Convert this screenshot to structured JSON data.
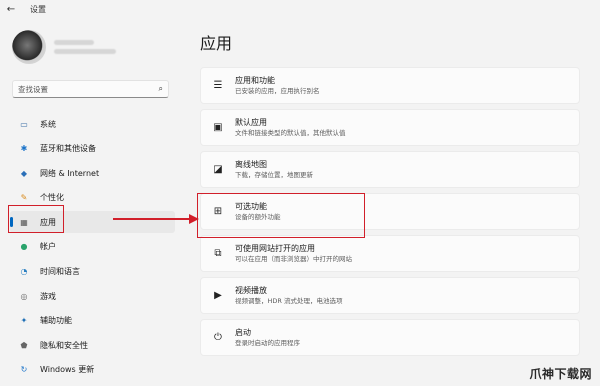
{
  "window": {
    "title": "设置"
  },
  "search": {
    "placeholder": "查找设置"
  },
  "sidebar": {
    "items": [
      {
        "label": "系统",
        "icon": "display-icon"
      },
      {
        "label": "蓝牙和其他设备",
        "icon": "bluetooth-icon"
      },
      {
        "label": "网络 & Internet",
        "icon": "wifi-icon"
      },
      {
        "label": "个性化",
        "icon": "brush-icon"
      },
      {
        "label": "应用",
        "icon": "apps-icon",
        "active": true
      },
      {
        "label": "帐户",
        "icon": "person-icon"
      },
      {
        "label": "时间和语言",
        "icon": "globe-clock-icon"
      },
      {
        "label": "游戏",
        "icon": "gamepad-icon"
      },
      {
        "label": "辅助功能",
        "icon": "accessibility-icon"
      },
      {
        "label": "隐私和安全性",
        "icon": "shield-icon"
      },
      {
        "label": "Windows 更新",
        "icon": "update-icon"
      }
    ]
  },
  "main": {
    "title": "应用",
    "cards": [
      {
        "title": "应用和功能",
        "desc": "已安装的应用，应用执行别名",
        "icon": "list-icon"
      },
      {
        "title": "默认应用",
        "desc": "文件和链接类型的默认值，其他默认值",
        "icon": "default-apps-icon"
      },
      {
        "title": "离线地图",
        "desc": "下载，存储位置，地图更新",
        "icon": "map-icon"
      },
      {
        "title": "可选功能",
        "desc": "设备的额外功能",
        "icon": "optional-features-icon",
        "highlighted": true
      },
      {
        "title": "可使用网站打开的应用",
        "desc": "可以在应用（而非浏览器）中打开的网站",
        "icon": "web-open-icon"
      },
      {
        "title": "视频播放",
        "desc": "视频调整，HDR 流式处理，电池选项",
        "icon": "video-icon"
      },
      {
        "title": "启动",
        "desc": "登录时启动的应用程序",
        "icon": "startup-icon"
      }
    ]
  },
  "watermark": "爪神下载网",
  "colors": {
    "accent": "#0067c0",
    "highlight": "#d11f2a",
    "background": "#f3f3f3"
  }
}
